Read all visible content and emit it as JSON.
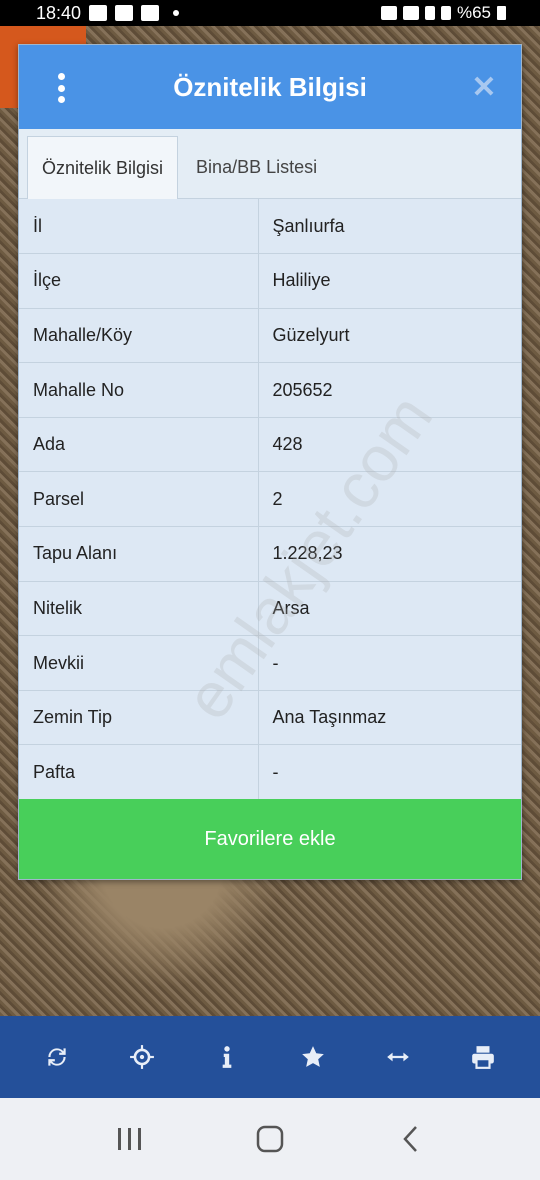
{
  "status_bar": {
    "time": "18:40",
    "battery": "%65"
  },
  "dialog": {
    "title": "Öznitelik Bilgisi",
    "tabs": [
      {
        "label": "Öznitelik Bilgisi",
        "active": true
      },
      {
        "label": "Bina/BB Listesi",
        "active": false
      }
    ],
    "rows": [
      {
        "key": "İl",
        "value": "Şanlıurfa"
      },
      {
        "key": "İlçe",
        "value": "Haliliye"
      },
      {
        "key": "Mahalle/Köy",
        "value": "Güzelyurt"
      },
      {
        "key": "Mahalle No",
        "value": "205652"
      },
      {
        "key": "Ada",
        "value": "428"
      },
      {
        "key": "Parsel",
        "value": "2"
      },
      {
        "key": "Tapu Alanı",
        "value": "1.228,23"
      },
      {
        "key": "Nitelik",
        "value": "Arsa"
      },
      {
        "key": "Mevkii",
        "value": "-"
      },
      {
        "key": "Zemin Tip",
        "value": "Ana Taşınmaz"
      },
      {
        "key": "Pafta",
        "value": "-"
      }
    ],
    "favorite_button": "Favorilere ekle"
  },
  "watermark": "emlakjet.com",
  "toolbar": {
    "icons": [
      "refresh-icon",
      "crosshair-icon",
      "info-icon",
      "star-icon",
      "measure-icon",
      "print-icon"
    ]
  },
  "navbar": {
    "icons": [
      "recent-apps-icon",
      "home-icon",
      "back-icon"
    ]
  },
  "colors": {
    "header_blue": "#4a93e6",
    "toolbar_blue": "#24509a",
    "favorite_green": "#48cf5a"
  }
}
